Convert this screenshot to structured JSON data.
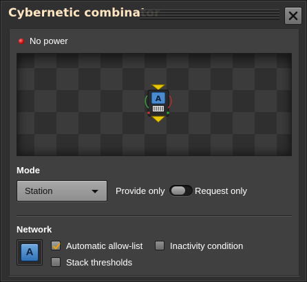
{
  "window": {
    "title": "Cybernetic combinator"
  },
  "status": {
    "text": "No power",
    "indicator_color": "#e00000"
  },
  "entity_preview": {
    "signal_letter": "A"
  },
  "mode": {
    "label": "Mode",
    "dropdown_value": "Station",
    "switch_left_label": "Provide only",
    "switch_right_label": "Request only"
  },
  "network": {
    "label": "Network",
    "signal_letter": "A",
    "automatic_allow_list": {
      "label": "Automatic allow-list",
      "checked": true
    },
    "inactivity_condition": {
      "label": "Inactivity condition",
      "checked": false
    },
    "stack_thresholds": {
      "label": "Stack thresholds",
      "checked": false
    }
  },
  "colors": {
    "title": "#ffe6c0",
    "checkbox_check": "#f0a000",
    "signal_tile": "#4a8bd0"
  }
}
